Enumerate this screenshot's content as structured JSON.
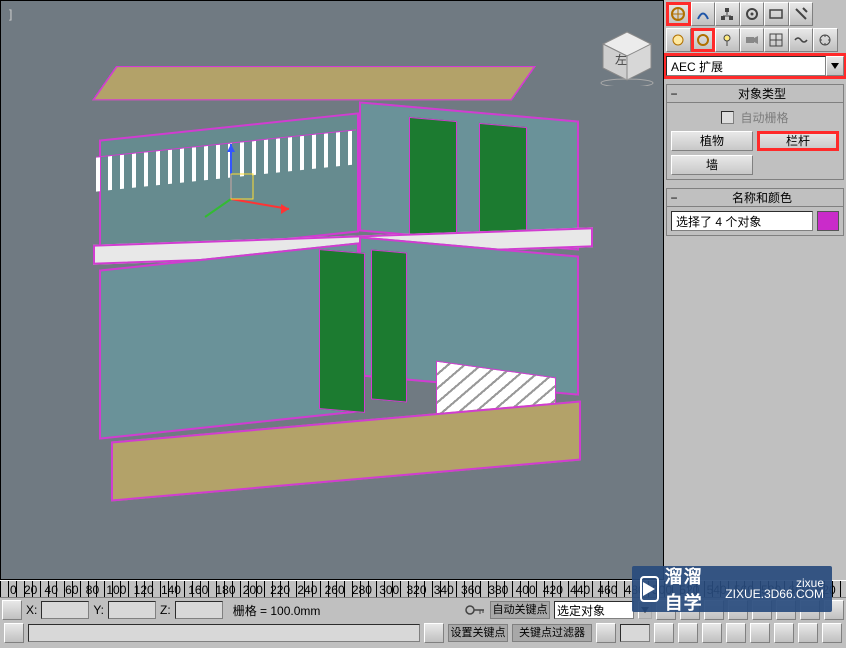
{
  "viewport": {
    "label": "]"
  },
  "ruler": {
    "ticks": [
      "0",
      "20",
      "40",
      "60",
      "80",
      "100",
      "120",
      "140",
      "160",
      "180",
      "200",
      "220",
      "240",
      "260",
      "280",
      "300",
      "320",
      "340",
      "360",
      "380",
      "400",
      "420",
      "440",
      "460",
      "480",
      "500",
      "520",
      "540",
      "560",
      "580",
      "600",
      "620"
    ]
  },
  "coords": {
    "x_label": "X:",
    "y_label": "Y:",
    "z_label": "Z:",
    "x": "",
    "y": "",
    "z": ""
  },
  "grid_text": "栅格 = 100.0mm",
  "autokey": "自动关键点",
  "setkey": "设置关键点",
  "filter": "选定对象",
  "keypoint": "关键点过滤器",
  "cmd_panel": {
    "dropdown": "AEC 扩展",
    "rollout_objtype_title": "对象类型",
    "auto_grid": "自动栅格",
    "btn_plant": "植物",
    "btn_rail": "栏杆",
    "btn_wall": "墙",
    "rollout_name_title": "名称和颜色",
    "name_value": "选择了 4 个对象"
  },
  "watermark": {
    "brand": "溜溜自学",
    "sub1": "zixue",
    "sub2": "ZIXUE.3D66.COM"
  }
}
